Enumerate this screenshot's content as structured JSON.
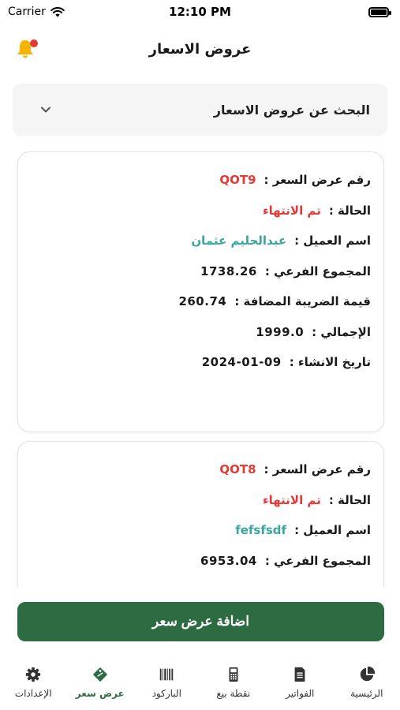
{
  "status_bar": {
    "carrier": "Carrier",
    "time": "12:10 PM"
  },
  "header": {
    "title": "عروض الاسعار"
  },
  "search": {
    "label": "البحث عن عروض الاسعار"
  },
  "quotes": [
    {
      "number_label": "رقم عرض السعر :",
      "number": "QOT9",
      "status_label": "الحالة :",
      "status": "تم الانتهاء",
      "customer_label": "اسم العميل :",
      "customer": "عبدالحليم عثمان",
      "subtotal_label": "المجموع الفرعي :",
      "subtotal": "1738.26",
      "vat_label": "قيمة الضريبة المضافة :",
      "vat": "260.74",
      "total_label": "الإجمالي :",
      "total": "1999.0",
      "created_label": "تاريخ الانشاء :",
      "created": "2024-01-09"
    },
    {
      "number_label": "رقم عرض السعر :",
      "number": "QOT8",
      "status_label": "الحالة :",
      "status": "تم الانتهاء",
      "customer_label": "اسم العميل :",
      "customer": "fefsfsdf",
      "subtotal_label": "المجموع الفرعي :",
      "subtotal": "6953.04"
    }
  ],
  "add_button": {
    "label": "اضافة عرض سعر"
  },
  "nav": [
    {
      "label": "الإعدادات",
      "icon": "gear-icon"
    },
    {
      "label": "عرض سعر",
      "icon": "tag-icon",
      "active": true
    },
    {
      "label": "الباركود",
      "icon": "barcode-icon"
    },
    {
      "label": "نقطة بيع",
      "icon": "pos-icon"
    },
    {
      "label": "الفواتير",
      "icon": "invoice-icon"
    },
    {
      "label": "الرئيسية",
      "icon": "pie-chart-icon"
    }
  ],
  "colors": {
    "accent": "#2d6b43",
    "red": "#e53935",
    "teal": "#3aa6a0",
    "bell": "#f4b400"
  }
}
